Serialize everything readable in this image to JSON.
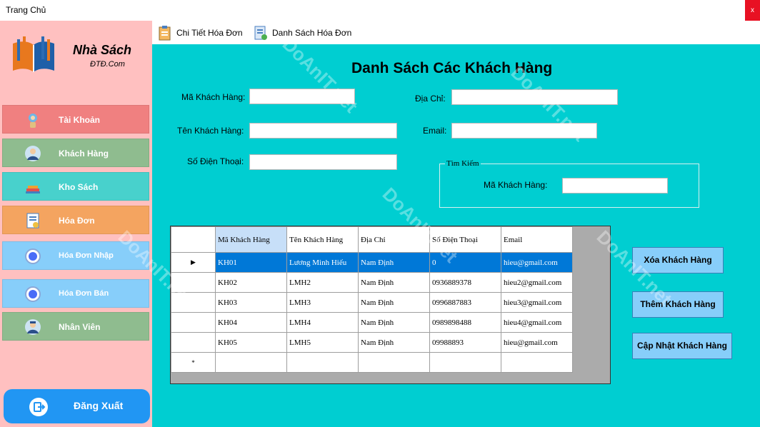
{
  "window": {
    "title": "Trang Chủ",
    "close_glyph": "x"
  },
  "brand": {
    "name": "Nhà Sách",
    "subtitle": "ĐTĐ.Com",
    "logo_icon": "book-logo-icon"
  },
  "sidebar": {
    "items": [
      {
        "label": "Tài Khoản",
        "icon": "account-icon",
        "color": "#f08080"
      },
      {
        "label": "Khách Hàng",
        "icon": "customer-icon",
        "color": "#8fbc8f"
      },
      {
        "label": "Kho Sách",
        "icon": "book-stack-icon",
        "color": "#48d1cc"
      },
      {
        "label": "Hóa Đơn",
        "icon": "invoice-icon",
        "color": "#f4a460"
      },
      {
        "label": "Hóa Đơn Nhập",
        "icon": "radio-icon",
        "color": "#87cefa"
      },
      {
        "label": "Hóa Đơn Bán",
        "icon": "radio-icon",
        "color": "#87cefa"
      },
      {
        "label": "Nhân Viên",
        "icon": "employee-icon",
        "color": "#8fbc8f"
      }
    ],
    "logout": {
      "label": "Đăng Xuất",
      "icon": "logout-icon",
      "color": "#2196f3"
    }
  },
  "menubar": {
    "items": [
      {
        "label": "Chi Tiết Hóa Đơn",
        "icon": "invoice-detail-icon"
      },
      {
        "label": "Danh Sách Hóa Đơn",
        "icon": "invoice-list-icon"
      }
    ]
  },
  "main": {
    "title": "Danh Sách Các Khách Hàng",
    "background": "#00ced1",
    "form": {
      "customer_id_label": "Mã Khách Hàng:",
      "address_label": "Địa Chỉ:",
      "customer_name_label": "Tên Khách Hàng:",
      "email_label": "Email:",
      "phone_label": "Số Điện Thoại:",
      "customer_id_value": "",
      "address_value": "",
      "customer_name_value": "",
      "email_value": "",
      "phone_value": ""
    },
    "search": {
      "legend": "Tìm Kiếm",
      "label": "Mã Khách Hàng:",
      "value": ""
    },
    "grid": {
      "columns": [
        "Mã Khách Hàng",
        "Tên Khách Hàng",
        "Địa Chỉ",
        "Số Điện Thoại",
        "Email"
      ],
      "rows": [
        [
          "KH01",
          "Lương Minh Hiếu",
          "Nam Định",
          "0",
          "hieu@gmail.com"
        ],
        [
          "KH02",
          "LMH2",
          "Nam Định",
          "0936889378",
          "hieu2@gmail.com"
        ],
        [
          "KH03",
          "LMH3",
          "Nam Định",
          "0996887883",
          "hieu3@gmail.com"
        ],
        [
          "KH04",
          "LMH4",
          "Nam Định",
          "0989898488",
          "hieu4@gmail.com"
        ],
        [
          "KH05",
          "LMH5",
          "Nam Định",
          "09988893",
          "hieu@gmail.com"
        ]
      ],
      "current_row_glyph": "▶",
      "new_row_glyph": "*"
    },
    "buttons": {
      "delete": "Xóa Khách Hàng",
      "add": "Thêm Khách Hàng",
      "update": "Cập Nhật Khách Hàng",
      "color": "#87cefa"
    }
  },
  "watermark": {
    "text": "DoAnIT.net"
  }
}
